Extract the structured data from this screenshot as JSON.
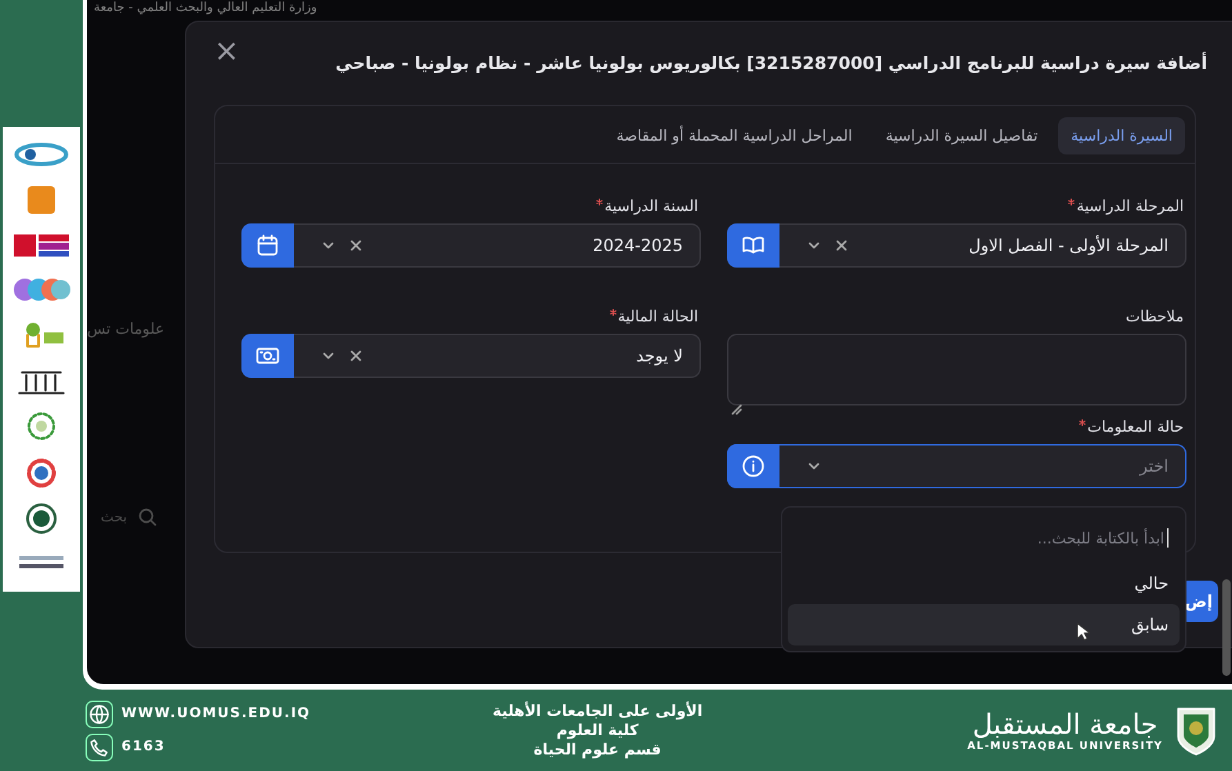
{
  "background_app": {
    "header_text": "وزارة التعليم العالي والبحث العلمي - جامعة",
    "side_text": "علومات تس",
    "search_placeholder": "بحث"
  },
  "dialog": {
    "close": "×",
    "title": "أضافة سيرة دراسية للبرنامج الدراسي [3215287000] بكالوريوس بولونيا عاشر - نظام بولونيا - صباحي",
    "tabs": [
      {
        "label": "السيرة الدراسية",
        "selected": true
      },
      {
        "label": "تفاصيل السيرة الدراسية",
        "selected": false
      },
      {
        "label": "المراحل الدراسية المحملة أو المقاصة",
        "selected": false
      }
    ],
    "fields": [
      {
        "kind": "select",
        "label": "المرحلة الدراسية",
        "required": true,
        "value": "المرحلة الأولى - الفصل الاول",
        "clearable": true,
        "focused": false
      },
      {
        "kind": "select",
        "label": "السنة الدراسية",
        "required": true,
        "value": "2024-2025",
        "clearable": true,
        "focused": false
      },
      {
        "kind": "textarea",
        "label": "ملاحظات",
        "required": false
      },
      {
        "kind": "select",
        "label": "الحالة المالية",
        "required": true,
        "value": "لا يوجد",
        "clearable": true,
        "focused": false
      },
      {
        "kind": "select",
        "label": "حالة المعلومات",
        "required": true,
        "placeholder": "اختر",
        "clearable": false,
        "focused": true
      }
    ],
    "dropdown": {
      "search_placeholder": "ابدأ بالكتابة للبحث...",
      "options": [
        {
          "label": "حالي",
          "hovered": false
        },
        {
          "label": "سابق",
          "hovered": true
        }
      ]
    },
    "submit_button": "إض"
  },
  "branding": {
    "website": "WWW.UOMUS.EDU.IQ",
    "phone": "6163",
    "tagline": [
      "الأولى على الجامعات الأهلية",
      "كلية العلوم",
      "قسم علوم الحياة"
    ],
    "university_arabic": "جامعة المستقبل",
    "university_english": "AL-MUSTAQBAL UNIVERSITY"
  }
}
